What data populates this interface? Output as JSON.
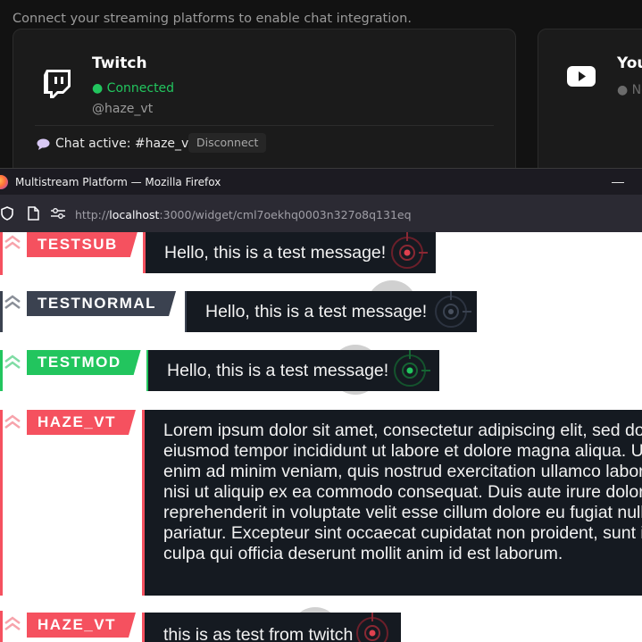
{
  "dashboard": {
    "subtitle": "Connect your streaming platforms to enable chat integration.",
    "twitch": {
      "name": "Twitch",
      "status": "● Connected",
      "handle": "@haze_vt",
      "chat_active": "Chat active: #haze_vt",
      "disconnect_label": "Disconnect"
    },
    "youtube": {
      "name": "YouTube",
      "status": "● Not connected"
    }
  },
  "browser": {
    "window_title": "Multistream Platform — Mozilla Firefox",
    "minimize_label": "—",
    "url_prefix": "http://",
    "url_host": "localhost",
    "url_rest": ":3000/widget/cml7oekhq0003n327o8q131eq"
  },
  "colors": {
    "sub": "#f5515f",
    "normal": "#3b4250",
    "mod": "#22c55e",
    "bubble_bg": "#151a21"
  },
  "messages": [
    {
      "username": "TESTSUB",
      "role": "sub",
      "text": "Hello, this is a test message!"
    },
    {
      "username": "TESTNORMAL",
      "role": "normal",
      "text": "Hello, this is a test message!"
    },
    {
      "username": "TESTMOD",
      "role": "mod",
      "text": "Hello, this is a test message!"
    },
    {
      "username": "HAZE_VT",
      "role": "sub",
      "text": "Lorem ipsum dolor sit amet, consectetur adipiscing elit, sed do eiusmod tempor incididunt ut labore et dolore magna aliqua. Ut enim ad minim veniam, quis nostrud exercitation ullamco laboris nisi ut aliquip ex ea commodo consequat. Duis aute irure dolor in reprehenderit in voluptate velit esse cillum dolore eu fugiat nulla pariatur. Excepteur sint occaecat cupidatat non proident, sunt in culpa qui officia deserunt mollit anim id est laborum."
    },
    {
      "username": "HAZE_VT",
      "role": "sub",
      "text": "this is as test from twitch"
    }
  ]
}
